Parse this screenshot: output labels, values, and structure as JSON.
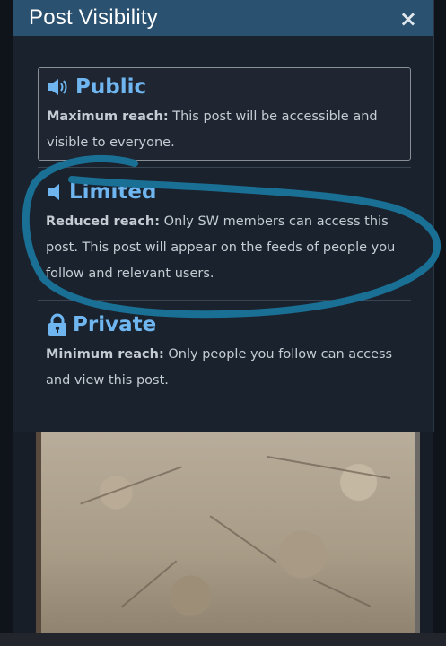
{
  "dialog": {
    "title": "Post Visibility",
    "close_label": "×"
  },
  "options": [
    {
      "key": "public",
      "label": "Public",
      "icon": "speaker-loud-icon",
      "reach_label": "Maximum reach:",
      "description": " This post will be accessible and visible to everyone.",
      "selected": true
    },
    {
      "key": "limited",
      "label": "Limited",
      "icon": "speaker-quiet-icon",
      "reach_label": "Reduced reach:",
      "description": " Only SW members can access this post. This post will appear on the feeds of people you follow and relevant users.",
      "selected": false
    },
    {
      "key": "private",
      "label": "Private",
      "icon": "lock-icon",
      "reach_label": "Minimum reach:",
      "description": " Only people you follow can access and view this post.",
      "selected": false
    }
  ],
  "colors": {
    "header": "#2a5170",
    "accent_label": "#6fb6f0",
    "annotation": "#1a6f95"
  }
}
